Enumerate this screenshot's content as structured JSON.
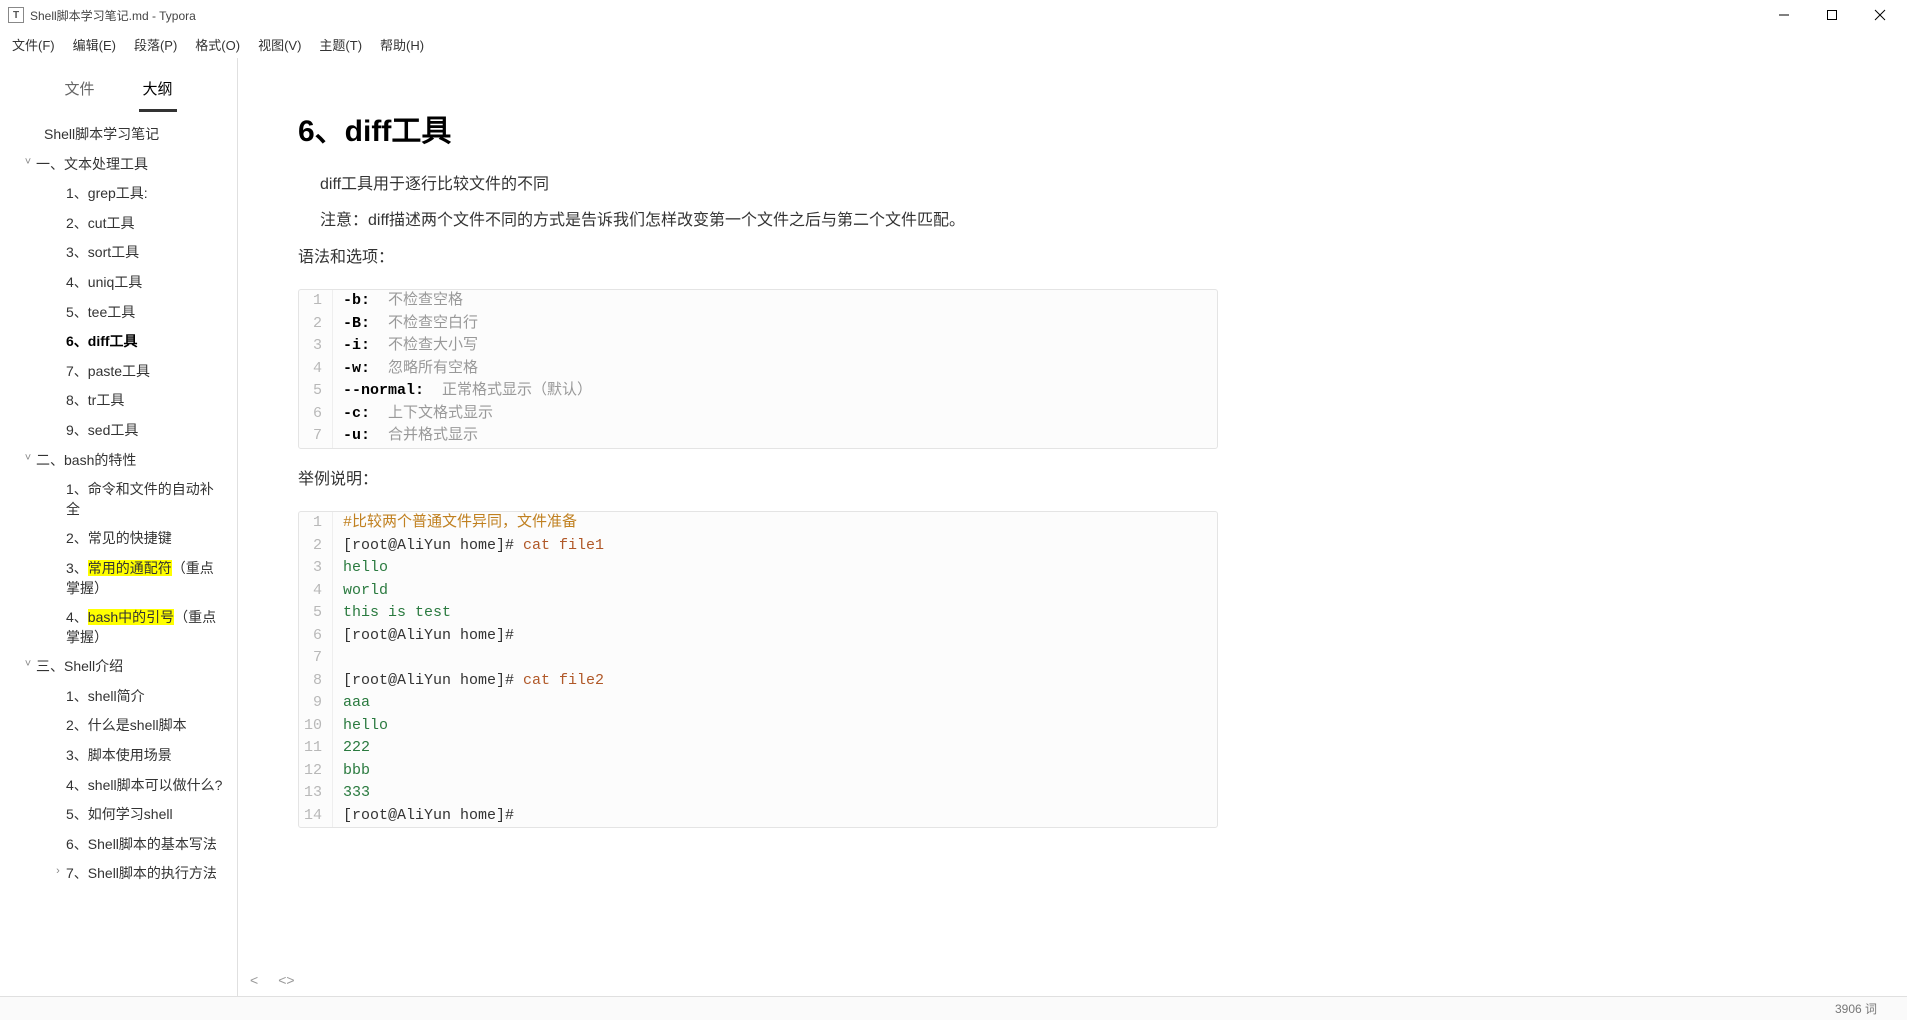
{
  "window": {
    "title": "Shell脚本学习笔记.md - Typora"
  },
  "menus": [
    "文件(F)",
    "编辑(E)",
    "段落(P)",
    "格式(O)",
    "视图(V)",
    "主题(T)",
    "帮助(H)"
  ],
  "sidebar_tabs": {
    "files": "文件",
    "outline": "大纲"
  },
  "outline": [
    {
      "lvl": 0,
      "label": "Shell脚本学习笔记",
      "toggle": ""
    },
    {
      "lvl": 1,
      "label": "一、文本处理工具",
      "toggle": "v"
    },
    {
      "lvl": 2,
      "label": "1、grep工具:"
    },
    {
      "lvl": 2,
      "label": "2、cut工具"
    },
    {
      "lvl": 2,
      "label": "3、sort工具"
    },
    {
      "lvl": 2,
      "label": "4、uniq工具"
    },
    {
      "lvl": 2,
      "label": "5、tee工具"
    },
    {
      "lvl": 2,
      "label": "6、diff工具",
      "active": true
    },
    {
      "lvl": 2,
      "label": "7、paste工具"
    },
    {
      "lvl": 2,
      "label": "8、tr工具"
    },
    {
      "lvl": 2,
      "label": "9、sed工具"
    },
    {
      "lvl": 1,
      "label": "二、bash的特性",
      "toggle": "v"
    },
    {
      "lvl": 2,
      "label": "1、命令和文件的自动补全"
    },
    {
      "lvl": 2,
      "label": "2、常见的快捷键"
    },
    {
      "lvl": 2,
      "label_pre": "3、",
      "hl": "常用的通配符",
      "label_post": "（重点掌握）"
    },
    {
      "lvl": 2,
      "label_pre": "4、",
      "hl": "bash中的引号",
      "label_post": "（重点掌握）"
    },
    {
      "lvl": 1,
      "label": "三、Shell介绍",
      "toggle": "v"
    },
    {
      "lvl": 2,
      "label": "1、shell简介"
    },
    {
      "lvl": 2,
      "label": "2、什么是shell脚本"
    },
    {
      "lvl": 2,
      "label": "3、脚本使用场景"
    },
    {
      "lvl": 2,
      "label": "4、shell脚本可以做什么?"
    },
    {
      "lvl": 2,
      "label": "5、如何学习shell"
    },
    {
      "lvl": 2,
      "label": "6、Shell脚本的基本写法"
    },
    {
      "lvl": 2,
      "label": "7、Shell脚本的执行方法",
      "toggle": ">"
    }
  ],
  "doc": {
    "heading": "6、diff工具",
    "intro1": "diff工具用于逐行比较文件的不同",
    "intro2": "注意：diff描述两个文件不同的方式是告诉我们怎样改变第一个文件之后与第二个文件匹配。",
    "syntax_label": "语法和选项：",
    "options": [
      {
        "flag": "-b:",
        "desc": "不检查空格"
      },
      {
        "flag": "-B:",
        "desc": "不检查空白行"
      },
      {
        "flag": "-i:",
        "desc": "不检查大小写"
      },
      {
        "flag": "-w:",
        "desc": "忽略所有空格"
      },
      {
        "flag": "--normal:",
        "desc": "正常格式显示（默认）"
      },
      {
        "flag": "-c:",
        "desc": "上下文格式显示"
      },
      {
        "flag": "-u:",
        "desc": "合并格式显示"
      }
    ],
    "example_label": "举例说明：",
    "example": [
      {
        "n": 1,
        "type": "comment",
        "text": "#比较两个普通文件异同，文件准备"
      },
      {
        "n": 2,
        "type": "cmd",
        "prompt": "[root@AliYun home]# ",
        "cmd": "cat file1"
      },
      {
        "n": 3,
        "type": "out",
        "text": "hello"
      },
      {
        "n": 4,
        "type": "out",
        "text": "world"
      },
      {
        "n": 5,
        "type": "out",
        "text": "this is test"
      },
      {
        "n": 6,
        "type": "prompt",
        "prompt": "[root@AliYun home]# "
      },
      {
        "n": 7,
        "type": "blank"
      },
      {
        "n": 8,
        "type": "cmd",
        "prompt": "[root@AliYun home]# ",
        "cmd": "cat file2"
      },
      {
        "n": 9,
        "type": "out",
        "text": "aaa"
      },
      {
        "n": 10,
        "type": "out",
        "text": "hello"
      },
      {
        "n": 11,
        "type": "out",
        "text": "222"
      },
      {
        "n": 12,
        "type": "out",
        "text": "bbb"
      },
      {
        "n": 13,
        "type": "out",
        "text": "333"
      },
      {
        "n": 14,
        "type": "prompt",
        "prompt": "[root@AliYun home]# "
      }
    ]
  },
  "status": {
    "words": "3906 词"
  }
}
